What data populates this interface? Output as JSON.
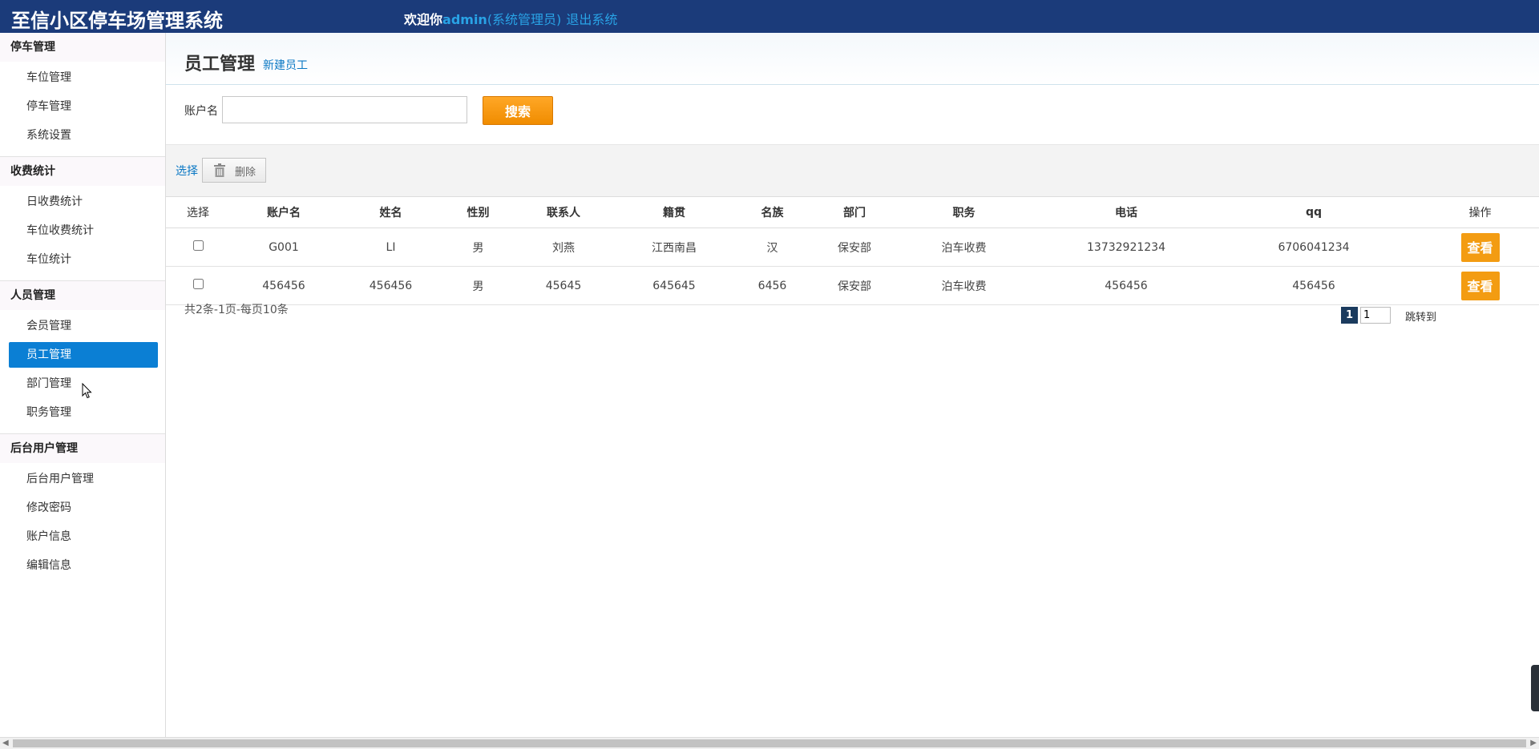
{
  "header": {
    "app_title": "至信小区停车场管理系统",
    "welcome": "欢迎你",
    "username": "admin",
    "role": "(系统管理员)",
    "logout": "退出系统",
    "bg_color": "#1b3b7a",
    "link_color": "#29a3e6"
  },
  "sidebar": {
    "groups": [
      {
        "title": "停车管理",
        "items": [
          "车位管理",
          "停车管理",
          "系统设置"
        ]
      },
      {
        "title": "收费统计",
        "items": [
          "日收费统计",
          "车位收费统计",
          "车位统计"
        ]
      },
      {
        "title": "人员管理",
        "items": [
          "会员管理",
          "员工管理",
          "部门管理",
          "职务管理"
        ]
      },
      {
        "title": "后台用户管理",
        "items": [
          "后台用户管理",
          "修改密码",
          "账户信息",
          "编辑信息"
        ]
      }
    ],
    "active_item": "员工管理",
    "active_color": "#0b7fd4"
  },
  "page": {
    "title": "员工管理",
    "new_link": "新建员工"
  },
  "search": {
    "label": "账户名",
    "value": "",
    "button": "搜索"
  },
  "toolbar": {
    "select": "选择",
    "delete": "删除"
  },
  "table": {
    "headers": [
      "选择",
      "账户名",
      "姓名",
      "性别",
      "联系人",
      "籍贯",
      "名族",
      "部门",
      "职务",
      "电话",
      "qq",
      "操作"
    ],
    "rows": [
      {
        "account": "G001",
        "name": "LI",
        "gender": "男",
        "contact": "刘燕",
        "origin": "江西南昌",
        "ethnic": "汉",
        "dept": "保安部",
        "position": "泊车收费",
        "phone": "13732921234",
        "qq": "6706041234",
        "action": "查看"
      },
      {
        "account": "456456",
        "name": "456456",
        "gender": "男",
        "contact": "45645",
        "origin": "645645",
        "ethnic": "6456",
        "dept": "保安部",
        "position": "泊车收费",
        "phone": "456456",
        "qq": "456456",
        "action": "查看"
      }
    ]
  },
  "pager": {
    "info": "共2条-1页-每页10条",
    "current": "1",
    "input_value": "1",
    "jump": "跳转到"
  }
}
